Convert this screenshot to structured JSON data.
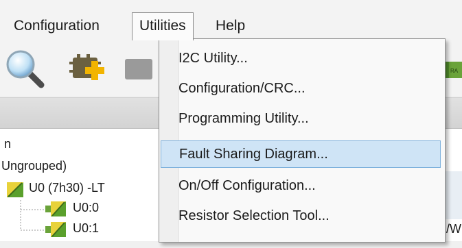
{
  "menubar": {
    "items": [
      {
        "label": "Configuration"
      },
      {
        "label": "Utilities"
      },
      {
        "label": "Help"
      }
    ]
  },
  "toolbar": {
    "buttons": [
      {
        "icon": "search-icon"
      },
      {
        "icon": "add-device-icon"
      },
      {
        "icon": "device-icon"
      },
      {
        "icon": "device-icon"
      }
    ]
  },
  "tree": {
    "partial_label": "n",
    "group_label": "Ungrouped)",
    "device_label": "U0 (7h30) -LT",
    "children": [
      {
        "label": "U0:0"
      },
      {
        "label": "U0:1"
      }
    ],
    "partial_right_text": "/W"
  },
  "utilities_menu": {
    "items": [
      {
        "label": "I2C Utility..."
      },
      {
        "label": "Configuration/CRC..."
      },
      {
        "label": "Programming Utility..."
      },
      {
        "label": "Fault Sharing Diagram..."
      },
      {
        "label": "On/Off Configuration..."
      },
      {
        "label": "Resistor Selection Tool..."
      }
    ],
    "highlighted_index": 3
  },
  "colors": {
    "highlight": "#cfe4f6",
    "highlight_border": "#7fb2dd",
    "device_icon_yellow": "#e8d23a",
    "device_icon_green": "#5aa02c"
  }
}
